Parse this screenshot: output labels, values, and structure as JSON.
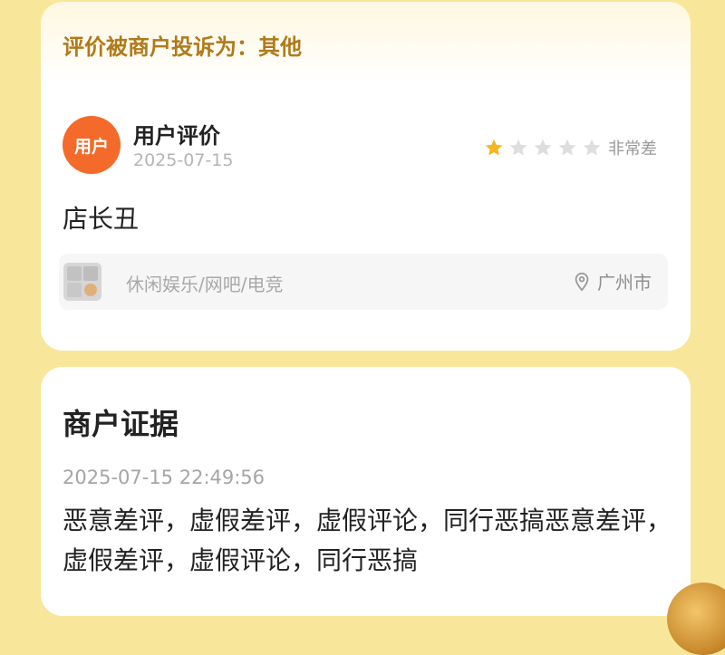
{
  "complaint": {
    "label": "评价被商户投诉为：其他"
  },
  "review": {
    "avatar_text": "用户",
    "user_name": "用户评价",
    "date": "2025-07-15",
    "rating": {
      "filled": 1,
      "total": 5,
      "text": "非常差"
    },
    "comment": "店长丑"
  },
  "store": {
    "category": "休闲娱乐/网吧/电竞",
    "location": "广州市"
  },
  "evidence": {
    "title": "商户证据",
    "timestamp": "2025-07-15 22:49:56",
    "text": "恶意差评，虚假差评，虚假评论，同行恶搞恶意差评，虚假差评，虚假评论，同行恶搞"
  },
  "colors": {
    "background": "#f8e79a",
    "avatar": "#f46a2a",
    "star_filled": "#f5b61f",
    "star_empty": "#dedede",
    "complaint_text": "#b07a1a"
  },
  "icons": {
    "star": "star-icon",
    "location": "location-pin-icon",
    "store_thumbnail": "store-thumbnail-icon"
  }
}
